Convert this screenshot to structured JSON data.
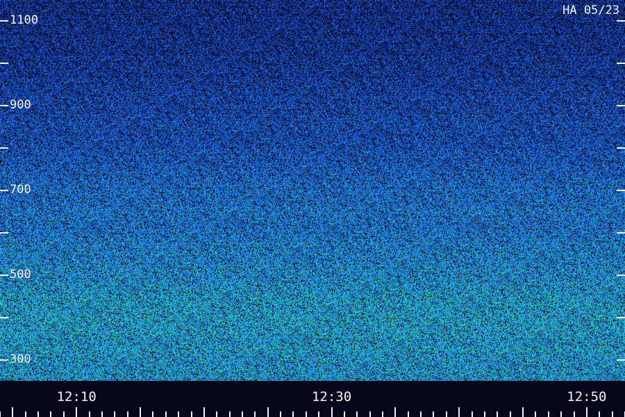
{
  "station_label": "HA 05/23",
  "chart_data": {
    "type": "heatmap",
    "title": "",
    "xlabel": "",
    "ylabel": "",
    "xlim": [
      "12:04",
      "12:53"
    ],
    "ylim": [
      250,
      1150
    ],
    "y_tick_labels": [
      "1100",
      "900",
      "700",
      "500",
      "300"
    ],
    "y_tick_values": [
      1100,
      900,
      700,
      500,
      300
    ],
    "y_minor_tick_values": [
      1000,
      800,
      600,
      400
    ],
    "x_tick_labels": [
      "12:10",
      "12:30",
      "12:50"
    ],
    "x_tick_values": [
      "12:10",
      "12:30",
      "12:50"
    ],
    "colormap": [
      "#000000",
      "#0a1a6e",
      "#1f55d6",
      "#1fa0e6",
      "#2fe0a0"
    ],
    "intensity_profile": [
      {
        "y": 1100,
        "level": 0.35
      },
      {
        "y": 1000,
        "level": 0.4
      },
      {
        "y": 900,
        "level": 0.5
      },
      {
        "y": 800,
        "level": 0.55
      },
      {
        "y": 700,
        "level": 0.7
      },
      {
        "y": 600,
        "level": 0.75
      },
      {
        "y": 500,
        "level": 0.85
      },
      {
        "y": 400,
        "level": 0.95
      },
      {
        "y": 300,
        "level": 0.9
      }
    ]
  }
}
